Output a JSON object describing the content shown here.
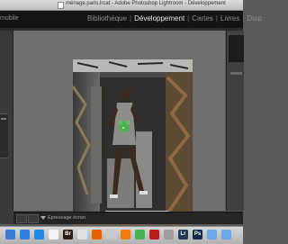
{
  "window": {
    "title": "ménage.paris.lrcat - Adobe Photoshop Lightroom - Développement"
  },
  "module_bar": {
    "identity_plate": "mobile",
    "tabs": [
      {
        "label": "Bibliothèque",
        "active": false
      },
      {
        "label": "Développement",
        "active": true
      },
      {
        "label": "Cartes",
        "active": false
      },
      {
        "label": "Livres",
        "active": false
      },
      {
        "label": "Diap",
        "active": false
      }
    ]
  },
  "toolbar": {
    "soft_proof_label": "Epreuvage écran"
  },
  "photo": {
    "subject": "figure-in-graffiti-doorway"
  },
  "dock": {
    "apps": [
      {
        "name": "finder-icon",
        "color": "#3a7bd5",
        "text": ""
      },
      {
        "name": "safari-icon",
        "color": "#2f7fe0",
        "text": ""
      },
      {
        "name": "appstore-icon",
        "color": "#1e88e5",
        "text": ""
      },
      {
        "name": "calendar-icon",
        "color": "#f2f2f2",
        "text": ""
      },
      {
        "name": "bridge-icon",
        "color": "#2b1c10",
        "text": "Br"
      },
      {
        "name": "chrome-icon",
        "color": "#e0e0e0",
        "text": ""
      },
      {
        "name": "firefox-icon",
        "color": "#e66000",
        "text": ""
      },
      {
        "name": "itunes-icon",
        "color": "#c8c8c8",
        "text": ""
      },
      {
        "name": "firefox2-icon",
        "color": "#f07a10",
        "text": ""
      },
      {
        "name": "maps-icon",
        "color": "#4caf50",
        "text": ""
      },
      {
        "name": "acrobat-icon",
        "color": "#b71c1c",
        "text": ""
      },
      {
        "name": "trash-full-icon",
        "color": "#9e9e9e",
        "text": ""
      },
      {
        "name": "lightroom-icon",
        "color": "#223a55",
        "text": "Lr"
      },
      {
        "name": "photoshop-icon",
        "color": "#0f2c4a",
        "text": "Ps"
      },
      {
        "name": "folder-icon",
        "color": "#6aa8e8",
        "text": ""
      },
      {
        "name": "folder2-icon",
        "color": "#6aa8e8",
        "text": ""
      }
    ]
  }
}
